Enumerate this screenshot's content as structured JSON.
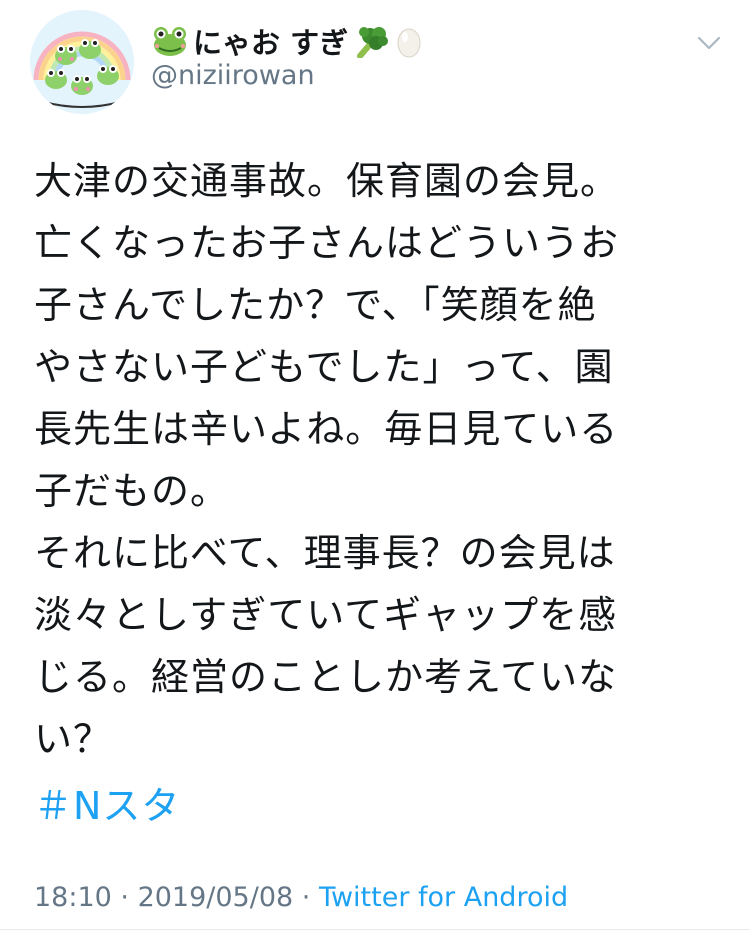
{
  "author": {
    "display_name": "にゃお すぎ",
    "handle": "@niziirowan",
    "name_emojis": [
      "frog-emoji",
      "broccoli-emoji",
      "egg-emoji"
    ]
  },
  "tweet": {
    "lines": [
      "大津の交通事故。保育園の会見。",
      "亡くなったお子さんはどういうお",
      "子さんでしたか？で、「笑顔を絶",
      "やさない子どもでした」って、園",
      "長先生は辛いよね。毎日見ている",
      "子だもの。",
      "それに比べて、理事長？の会見は",
      "淡々としすぎていてギャップを感",
      "じる。経営のことしか考えていな",
      "い？"
    ],
    "hashtag": "＃Nスタ"
  },
  "meta": {
    "time": "18:10",
    "separator": " · ",
    "date": "2019/05/08",
    "source": "Twitter for Android"
  },
  "colors": {
    "text": "#14171a",
    "secondary": "#657786",
    "link": "#1da1f2"
  }
}
